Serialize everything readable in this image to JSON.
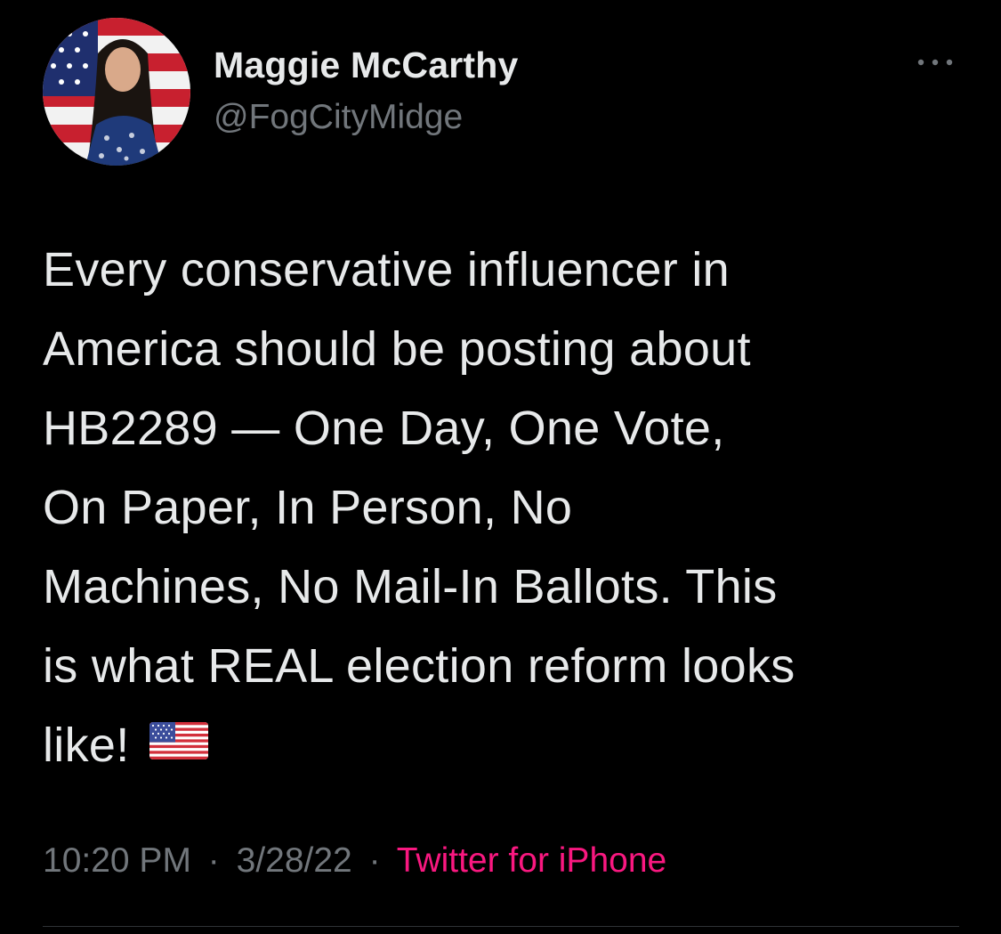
{
  "author": {
    "display_name": "Maggie McCarthy",
    "handle": "@FogCityMidge",
    "avatar": "profile-photo-woman-with-american-flag"
  },
  "more_icon": "more-horizontal-icon",
  "tweet": {
    "lines": [
      "Every conservative influencer in",
      "America should be posting about",
      "HB2289 — One Day, One Vote,",
      "On Paper, In Person, No",
      "Machines, No Mail-In Ballots. This",
      "is what REAL election reform looks",
      "like!"
    ],
    "emoji": "us-flag-emoji"
  },
  "meta": {
    "time": "10:20 PM",
    "separator": "·",
    "date": "3/28/22",
    "source": "Twitter for iPhone"
  },
  "colors": {
    "background": "#000000",
    "text_primary": "#e7e9ea",
    "text_secondary": "#71767b",
    "source_link": "#f91880",
    "divider": "#2f3336"
  }
}
